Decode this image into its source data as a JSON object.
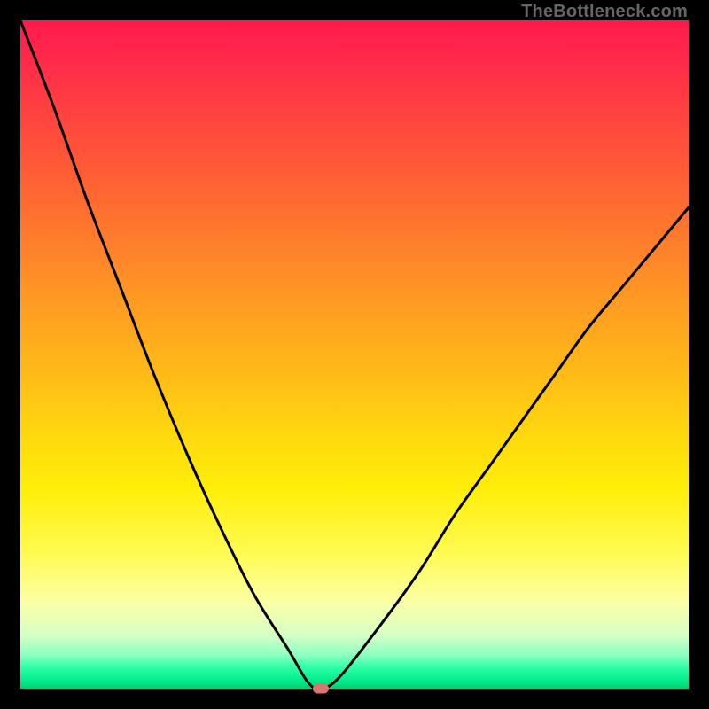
{
  "attribution": "TheBottleneck.com",
  "colors": {
    "curve_stroke": "#000000",
    "marker_fill": "#d9776e",
    "frame": "#000000"
  },
  "chart_data": {
    "type": "line",
    "title": "",
    "xlabel": "",
    "ylabel": "",
    "xlim": [
      0,
      100
    ],
    "ylim": [
      0,
      100
    ],
    "series": [
      {
        "name": "bottleneck-curve",
        "x": [
          0,
          5,
          10,
          15,
          20,
          25,
          30,
          35,
          40,
          43,
          45,
          48,
          55,
          60,
          65,
          70,
          75,
          80,
          85,
          90,
          95,
          100
        ],
        "values": [
          100,
          87,
          73,
          60,
          47,
          35,
          24,
          14,
          6,
          1,
          0,
          2,
          11,
          18,
          26,
          33,
          40,
          47,
          54,
          60,
          66,
          72
        ]
      }
    ],
    "marker": {
      "x": 45,
      "y": 0
    }
  }
}
